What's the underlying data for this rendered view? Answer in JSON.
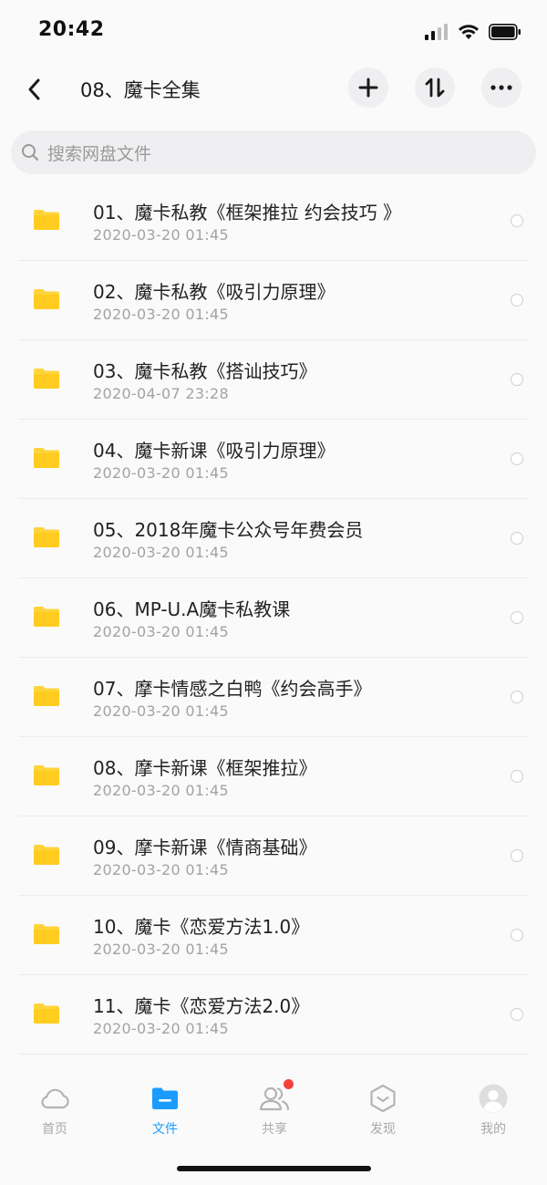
{
  "status_bar": {
    "time": "20:42"
  },
  "header": {
    "title": "08、魔卡全集",
    "back_icon": "chevron-left-icon",
    "add_icon": "plus-icon",
    "sort_icon": "sort-arrows-icon",
    "more_icon": "more-dots-icon"
  },
  "search": {
    "placeholder": "搜索网盘文件"
  },
  "files": [
    {
      "name": "01、魔卡私教《框架推拉 约会技巧 》",
      "date": "2020-03-20 01:45"
    },
    {
      "name": "02、魔卡私教《吸引力原理》",
      "date": "2020-03-20 01:45"
    },
    {
      "name": "03、魔卡私教《搭讪技巧》",
      "date": "2020-04-07 23:28"
    },
    {
      "name": "04、魔卡新课《吸引力原理》",
      "date": "2020-03-20 01:45"
    },
    {
      "name": "05、2018年魔卡公众号年费会员",
      "date": "2020-03-20 01:45"
    },
    {
      "name": "06、MP-U.A魔卡私教课",
      "date": "2020-03-20 01:45"
    },
    {
      "name": "07、摩卡情感之白鸭《约会高手》",
      "date": "2020-03-20 01:45"
    },
    {
      "name": "08、摩卡新课《框架推拉》",
      "date": "2020-03-20 01:45"
    },
    {
      "name": "09、摩卡新课《情商基础》",
      "date": "2020-03-20 01:45"
    },
    {
      "name": "10、魔卡《恋爱方法1.0》",
      "date": "2020-03-20 01:45"
    },
    {
      "name": "11、魔卡《恋爱方法2.0》",
      "date": "2020-03-20 01:45"
    }
  ],
  "tabs": [
    {
      "label": "首页",
      "icon": "cloud-icon",
      "active": false
    },
    {
      "label": "文件",
      "icon": "folder-icon",
      "active": true
    },
    {
      "label": "共享",
      "icon": "people-icon",
      "active": false,
      "badge": true
    },
    {
      "label": "发现",
      "icon": "discover-icon",
      "active": false
    },
    {
      "label": "我的",
      "icon": "avatar-icon",
      "active": false
    }
  ],
  "colors": {
    "accent": "#1a9cff",
    "folder": "#ffd43b",
    "badge": "#f5413b"
  }
}
